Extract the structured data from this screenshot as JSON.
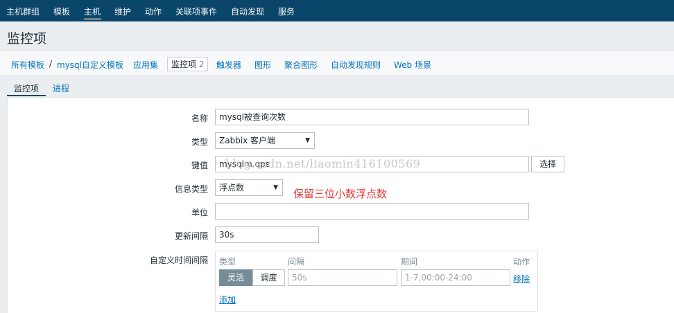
{
  "topnav": {
    "items": [
      "主机群组",
      "模板",
      "主机",
      "维护",
      "动作",
      "关联项事件",
      "自动发现",
      "服务"
    ],
    "active": "主机"
  },
  "page": {
    "title": "监控项"
  },
  "breadcrumbs": {
    "all_templates": "所有模板",
    "separator": "/",
    "template": "mysql自定义模板",
    "apps": "应用集",
    "items": "监控项",
    "items_count": "2",
    "triggers": "触发器",
    "graphs": "图形",
    "screens": "聚合图形",
    "discovery": "自动发现规则",
    "web": "Web 场景"
  },
  "subtabs": {
    "items": "监控项",
    "process": "进程"
  },
  "form": {
    "name_label": "名称",
    "name_value": "mysql被查询次数",
    "type_label": "类型",
    "type_value": "Zabbix 客户端",
    "key_label": "键值",
    "key_value": "mysqlm.qps",
    "select_button": "选择",
    "info_type_label": "信息类型",
    "info_type_value": "浮点数",
    "unit_label": "单位",
    "unit_value": "",
    "interval_label": "更新间隔",
    "interval_value": "30s",
    "custom_interval_label": "自定义时间间隔"
  },
  "annotation": {
    "note": "保留三位小数浮点数",
    "watermark": "blog.csdn.net/liaomin416100569"
  },
  "custom_intervals": {
    "headers": {
      "type": "类型",
      "interval": "间隔",
      "period": "期间",
      "action": "动作"
    },
    "flexible": "灵活",
    "scheduling": "调度",
    "interval_placeholder": "50s",
    "period_placeholder": "1-7,00:00-24:00",
    "remove": "移除",
    "add": "添加"
  },
  "colors": {
    "nav_bg": "#0a466a",
    "link": "#0274be",
    "note": "#e33734"
  }
}
